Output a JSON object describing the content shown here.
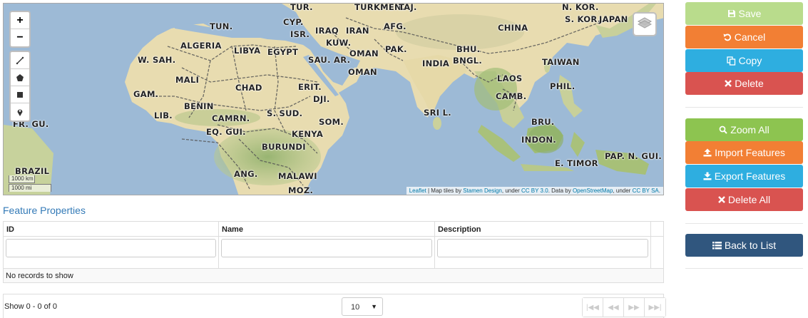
{
  "map": {
    "zoom_in_label": "+",
    "zoom_out_label": "−",
    "draw_tools": [
      "polyline-icon",
      "polygon-icon",
      "rectangle-icon",
      "marker-icon"
    ],
    "layers_icon": "layers-icon",
    "scale": {
      "km": "1000 km",
      "mi": "1000 mi"
    },
    "labels": {
      "tur": "TUR.",
      "turkmen": "TURKMEN.",
      "taj": "TAJ.",
      "nkor": "N. KOR.",
      "skor": "S. KOR.",
      "japan": "JAPAN",
      "tun": "TUN.",
      "cyp": "CYP.",
      "isr": "ISR.",
      "iraq": "IRAQ",
      "iran": "IRAN",
      "afg": "AFG.",
      "china": "CHINA",
      "kuw": "KUW.",
      "algeria": "ALGERIA",
      "libya": "LIBYA",
      "egypt": "EGYPT",
      "oman1": "OMAN",
      "pak": "PAK.",
      "bhu": "BHU.",
      "wsah": "W. SAH.",
      "sauar": "SAU. AR.",
      "india": "INDIA",
      "bngl": "BNGL.",
      "taiwan": "TAIWAN",
      "oman2": "OMAN",
      "mali": "MALI",
      "laos": "LAOS",
      "phil": "PHIL.",
      "eri": "ERIT.",
      "chad": "CHAD",
      "gam": "GAM.",
      "camb": "CAMB.",
      "dji": "DJI.",
      "benin": "BENIN",
      "srilanka": "SRI L.",
      "lib": "LIB.",
      "ssud": "S. SUD.",
      "camrn": "CAMRN.",
      "som": "SOM.",
      "bru": "BRU.",
      "frgu": "FR. GU.",
      "eqgui": "EQ. GUI.",
      "kenya": "KENYA",
      "indon": "INDON.",
      "burundi": "BURUNDI",
      "papngui": "PAP. N. GUI.",
      "brazil": "BRAZIL",
      "etimor": "E. TIMOR",
      "ang": "ANG.",
      "malawi": "MALAWI",
      "moz": "MOZ."
    },
    "attribution": {
      "leaflet": "Leaflet",
      "tiles_by": " | Map tiles by ",
      "stamen": "Stamen Design",
      "under1": ", under ",
      "ccby": "CC BY 3.0",
      "data_by": ". Data by ",
      "osm": "OpenStreetMap",
      "under2": ", under ",
      "ccbysa": "CC BY SA",
      "end": "."
    }
  },
  "feature_properties": {
    "title": "Feature Properties",
    "columns": [
      "ID",
      "Name",
      "Description"
    ],
    "filters": {
      "id": "",
      "name": "",
      "description": ""
    },
    "empty_message": "No records to show"
  },
  "pager": {
    "info": "Show 0 - 0 of 0",
    "page_size": "10",
    "nav_icons": [
      "first-page-icon",
      "prev-page-icon",
      "next-page-icon",
      "last-page-icon"
    ]
  },
  "buttons": {
    "save": "Save",
    "cancel": "Cancel",
    "copy": "Copy",
    "delete": "Delete",
    "zoom_all": "Zoom All",
    "import": "Import Features",
    "export": "Export Features",
    "delete_all": "Delete All",
    "back": "Back to List"
  },
  "colors": {
    "save": "#b9dc8c",
    "cancel": "#f27f34",
    "copy": "#2eaee0",
    "delete": "#d95350",
    "zoom_all": "#8dc450",
    "import": "#f27f34",
    "export": "#2eaee0",
    "delete_all": "#d95350",
    "back": "#30567e",
    "ocean": "#9dbad6",
    "land": "#e6dcb2",
    "link": "#337ab7"
  }
}
